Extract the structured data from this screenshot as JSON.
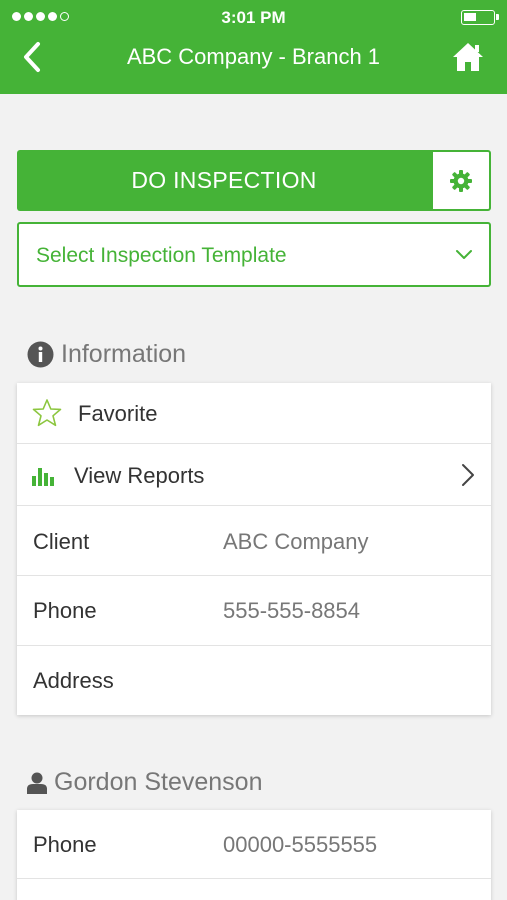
{
  "status_bar": {
    "time": "3:01 PM"
  },
  "header": {
    "title": "ABC Company - Branch 1",
    "back_icon": "chevron-left-icon",
    "home_icon": "home-icon"
  },
  "actions": {
    "do_inspection_label": "DO INSPECTION",
    "settings_icon": "gear-icon",
    "template_select_value": "Select Inspection Template"
  },
  "information": {
    "heading": "Information",
    "favorite_label": "Favorite",
    "view_reports_label": "View Reports",
    "fields": [
      {
        "label": "Client",
        "value": "ABC Company"
      },
      {
        "label": "Phone",
        "value": "555-555-8854"
      },
      {
        "label": "Address",
        "value": ""
      }
    ]
  },
  "contact": {
    "heading": "Gordon Stevenson",
    "fields": [
      {
        "label": "Phone",
        "value": "00000-5555555"
      }
    ]
  },
  "colors": {
    "accent": "#45b337",
    "background": "#f2f2f2"
  }
}
